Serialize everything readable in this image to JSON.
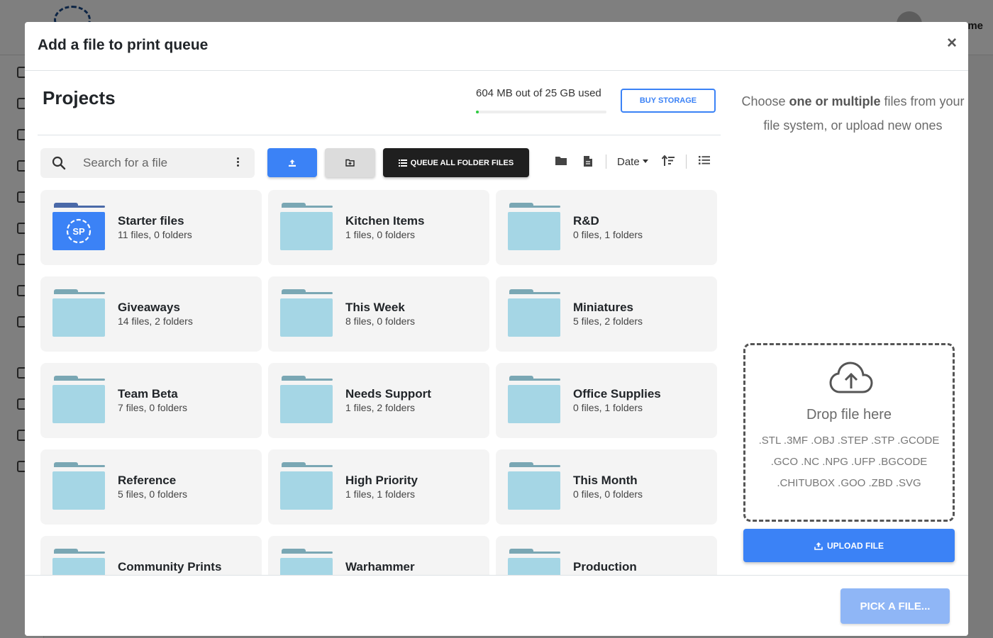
{
  "background": {
    "username": "me"
  },
  "modal": {
    "title": "Add a file to print queue",
    "close_label": "×"
  },
  "projects": {
    "title": "Projects",
    "storage_text": "604 MB out of 25 GB used",
    "storage_used_fraction": 0.024,
    "buy_storage_label": "BUY STORAGE"
  },
  "toolbar": {
    "search_placeholder": "Search for a file",
    "queue_all_label": "QUEUE ALL FOLDER FILES",
    "sort_label": "Date"
  },
  "folders": [
    {
      "name": "Starter files",
      "meta": "11 files, 0 folders",
      "icon": "sp-logo"
    },
    {
      "name": "Kitchen Items",
      "meta": "1 files, 0 folders"
    },
    {
      "name": "R&D",
      "meta": "0 files, 1 folders"
    },
    {
      "name": "Giveaways",
      "meta": "14 files, 2 folders"
    },
    {
      "name": "This Week",
      "meta": "8 files, 0 folders"
    },
    {
      "name": "Miniatures",
      "meta": "5 files, 2 folders"
    },
    {
      "name": "Team Beta",
      "meta": "7 files, 0 folders"
    },
    {
      "name": "Needs Support",
      "meta": "1 files, 2 folders"
    },
    {
      "name": "Office Supplies",
      "meta": "0 files, 1 folders"
    },
    {
      "name": "Reference",
      "meta": "5 files, 0 folders"
    },
    {
      "name": "High Priority",
      "meta": "1 files, 1 folders"
    },
    {
      "name": "This Month",
      "meta": "0 files, 0 folders"
    },
    {
      "name": "Community Prints",
      "meta": ""
    },
    {
      "name": "Warhammer",
      "meta": ""
    },
    {
      "name": "Production",
      "meta": ""
    }
  ],
  "right_pane": {
    "hint_pre": "Choose ",
    "hint_bold": "one or multiple",
    "hint_post": " files from your file system, or upload new ones",
    "drop_title": "Drop file here",
    "formats_line1": ".STL .3MF .OBJ .STEP .STP .GCODE",
    "formats_line2": ".GCO .NC .NPG .UFP .BGCODE",
    "formats_line3": ".CHITUBOX .GOO .ZBD .SVG",
    "upload_label": "UPLOAD FILE"
  },
  "footer": {
    "pick_label": "PICK A FILE..."
  },
  "colors": {
    "primary": "#3b82f6",
    "folder_body": "#a5d6e5",
    "folder_tab": "#7aa7b4",
    "storage_fill": "#2ecc40"
  }
}
